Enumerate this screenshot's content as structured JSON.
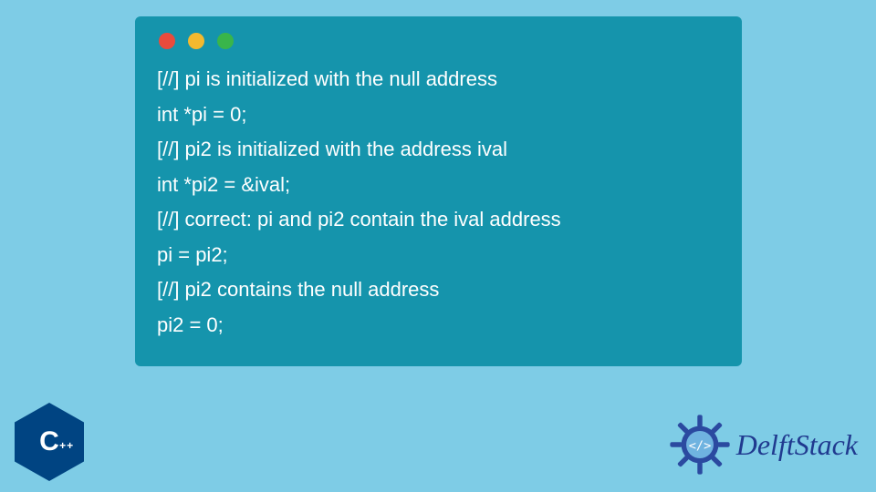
{
  "code": {
    "lines": [
      "[//] pi is initialized with the null address",
      "int *pi = 0;",
      "[//] pi2 is initialized with the address ival",
      "int *pi2 = &ival;",
      "[//] correct: pi and pi2 contain the ival address",
      "pi = pi2;",
      "[//] pi2 contains the null address",
      "pi2 = 0;"
    ]
  },
  "badges": {
    "cpp_letter": "C",
    "cpp_plus": "++"
  },
  "brand": {
    "name": "DelftStack"
  }
}
